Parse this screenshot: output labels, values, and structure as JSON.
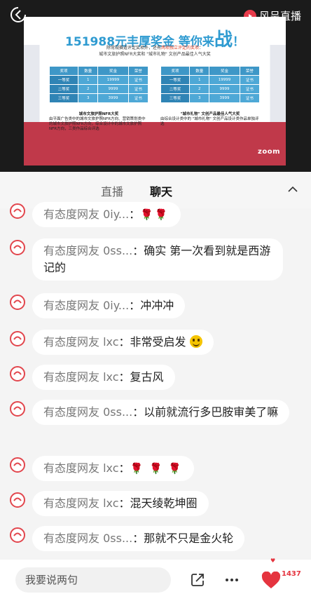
{
  "header": {
    "logo_text": "风呈直播",
    "brand_color": "#e83b4b"
  },
  "slide": {
    "title_prefix": "151988元丰厚奖金 等你来",
    "title_big": "战",
    "title_suffix": "！",
    "sub_line1_a": "除常规赛道评定奖项外，还有",
    "sub_line1_hl": "两项独立评定的奖项",
    "sub_line1_b": "：",
    "sub_line2": "城市文旅护照NFR大奖和 \"城市礼物\" 文创产品最佳人气大奖",
    "table_headers": [
      "奖项",
      "数量",
      "奖金",
      "荣誉"
    ],
    "left_rows": [
      [
        "一等奖",
        "1",
        "19999",
        "证书"
      ],
      [
        "二等奖",
        "2",
        "9999",
        "证书"
      ],
      [
        "三等奖",
        "3",
        "3999",
        "证书"
      ]
    ],
    "right_rows": [
      [
        "一等奖",
        "1",
        "19999",
        "证书"
      ],
      [
        "二等奖",
        "2",
        "9999",
        "证书"
      ],
      [
        "三等奖",
        "3",
        "3999",
        "证书"
      ]
    ],
    "left_caption_title": "城市文旅护照NFR大奖",
    "left_caption_text": "由平面广告类中的城市文旅护照NFR方向、营销策划类中的城市文旅护照NFR方向，综合设计中的城市文旅护照NFR方向，三类作品综合评选",
    "right_caption_title": "\"城市礼物\" 文创产品最佳人气大奖",
    "right_caption_text": "由综合设计类中的 \"城市礼物\" 文创产品设计类作品单独评选",
    "zoom_text": "zoom"
  },
  "tabs": {
    "live": "直播",
    "chat": "聊天"
  },
  "chat": [
    {
      "nick": "有态度网友 0iy...",
      "sep": "：",
      "text": "",
      "roses": "🌹🌹"
    },
    {
      "nick": "有态度网友 0ss...",
      "sep": "：",
      "text": "确实 第一次看到就是西游记的",
      "roses": ""
    },
    {
      "nick": "有态度网友 0iy...",
      "sep": "：",
      "text": "冲冲冲",
      "roses": ""
    },
    {
      "nick": "有态度网友 lxc",
      "sep": "：",
      "text": "非常受启发",
      "roses": ""
    },
    {
      "nick": "有态度网友 lxc",
      "sep": "：",
      "text": "复古风",
      "roses": ""
    },
    {
      "nick": "有态度网友 0ss...",
      "sep": "：",
      "text": "以前就流行多巴胺审美了嘛",
      "roses": ""
    },
    {
      "nick": "有态度网友 lxc",
      "sep": "：",
      "text": "",
      "roses": "🌹 🌹 🌹"
    },
    {
      "nick": "有态度网友 lxc",
      "sep": "：",
      "text": "混天绫乾坤圈",
      "roses": ""
    },
    {
      "nick": "有态度网友 0ss...",
      "sep": "：",
      "text": "那就不只是金火轮",
      "roses": ""
    }
  ],
  "bottom": {
    "input_placeholder": "我要说两句",
    "like_count": "1437",
    "accent_color": "#e5343f"
  }
}
